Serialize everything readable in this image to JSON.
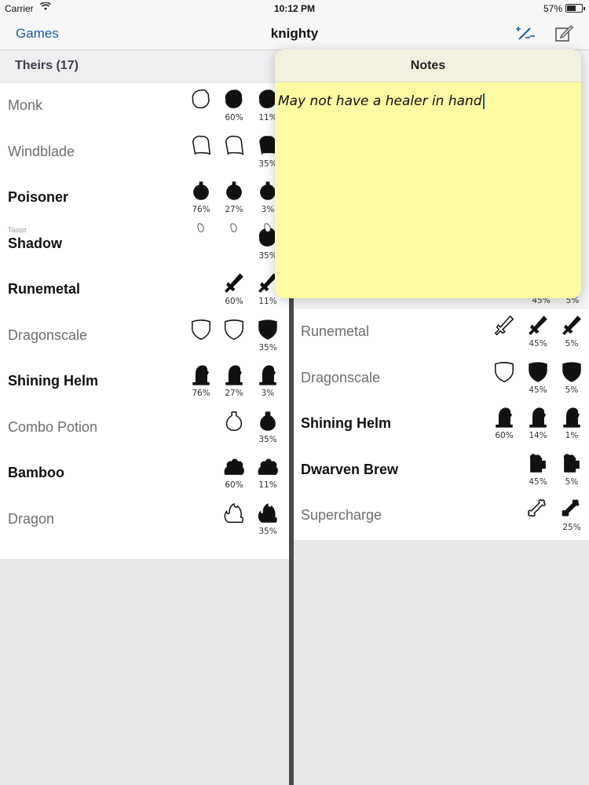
{
  "status_bar": {
    "carrier": "Carrier",
    "time": "10:12 PM",
    "battery": "57%"
  },
  "nav": {
    "back_label": "Games",
    "title": "knighty",
    "icons": [
      "wand-icon",
      "compose-icon"
    ]
  },
  "left_pane": {
    "section_title": "Theirs (17)",
    "rows": [
      {
        "name": "Monk",
        "active": false,
        "cells": [
          {
            "icon": "blob",
            "fill": "outline",
            "pct": ""
          },
          {
            "icon": "blob",
            "fill": "solid",
            "pct": "60%"
          },
          {
            "icon": "blob",
            "fill": "solid",
            "pct": "11%"
          }
        ]
      },
      {
        "name": "Windblade",
        "active": false,
        "cells": [
          {
            "icon": "cloak",
            "fill": "outline",
            "pct": ""
          },
          {
            "icon": "cloak",
            "fill": "outline",
            "pct": ""
          },
          {
            "icon": "cloak",
            "fill": "solid",
            "pct": "35%"
          }
        ]
      },
      {
        "name": "Poisoner",
        "active": true,
        "cells": [
          {
            "icon": "bomb",
            "fill": "solid",
            "pct": "76%"
          },
          {
            "icon": "bomb",
            "fill": "solid",
            "pct": "27%"
          },
          {
            "icon": "bomb",
            "fill": "solid",
            "pct": "3%"
          }
        ]
      },
      {
        "name": "Shadow",
        "active": true,
        "cells": [
          {
            "icon": "none",
            "fill": "",
            "pct": ""
          },
          {
            "icon": "none",
            "fill": "",
            "pct": ""
          },
          {
            "icon": "blob",
            "fill": "solid",
            "pct": "35%"
          }
        ]
      },
      {
        "name": "Runemetal",
        "active": true,
        "cells": [
          {
            "icon": "none",
            "fill": "",
            "pct": ""
          },
          {
            "icon": "sword",
            "fill": "solid",
            "pct": "60%"
          },
          {
            "icon": "sword",
            "fill": "solid",
            "pct": "11%"
          }
        ]
      },
      {
        "name": "Dragonscale",
        "active": false,
        "cells": [
          {
            "icon": "shield",
            "fill": "outline",
            "pct": ""
          },
          {
            "icon": "shield",
            "fill": "outline",
            "pct": ""
          },
          {
            "icon": "shield",
            "fill": "solid",
            "pct": "35%"
          }
        ]
      },
      {
        "name": "Shining Helm",
        "active": true,
        "cells": [
          {
            "icon": "helm",
            "fill": "solid",
            "pct": "76%"
          },
          {
            "icon": "helm",
            "fill": "solid",
            "pct": "27%"
          },
          {
            "icon": "helm",
            "fill": "solid",
            "pct": "3%"
          }
        ]
      },
      {
        "name": "Combo Potion",
        "active": false,
        "cells": [
          {
            "icon": "none",
            "fill": "",
            "pct": ""
          },
          {
            "icon": "potion",
            "fill": "outline",
            "pct": ""
          },
          {
            "icon": "potion",
            "fill": "solid",
            "pct": "35%"
          }
        ]
      },
      {
        "name": "Bamboo",
        "active": true,
        "cells": [
          {
            "icon": "none",
            "fill": "",
            "pct": ""
          },
          {
            "icon": "bush",
            "fill": "solid",
            "pct": "60%"
          },
          {
            "icon": "bush",
            "fill": "solid",
            "pct": "11%"
          }
        ]
      },
      {
        "name": "Dragon",
        "active": false,
        "cells": [
          {
            "icon": "none",
            "fill": "",
            "pct": ""
          },
          {
            "icon": "flame",
            "fill": "outline",
            "pct": ""
          },
          {
            "icon": "flame",
            "fill": "solid",
            "pct": "35%"
          }
        ]
      }
    ],
    "sublabel": "Taoist"
  },
  "right_pane": {
    "partial_pcts": [
      "45%",
      "5%"
    ],
    "rows": [
      {
        "name": "Runemetal",
        "active": false,
        "cells": [
          {
            "icon": "sword",
            "fill": "outline",
            "pct": ""
          },
          {
            "icon": "sword",
            "fill": "solid",
            "pct": "45%"
          },
          {
            "icon": "sword",
            "fill": "solid",
            "pct": "5%"
          }
        ]
      },
      {
        "name": "Dragonscale",
        "active": false,
        "cells": [
          {
            "icon": "shield",
            "fill": "outline",
            "pct": ""
          },
          {
            "icon": "shield",
            "fill": "solid",
            "pct": "45%"
          },
          {
            "icon": "shield",
            "fill": "solid",
            "pct": "5%"
          }
        ]
      },
      {
        "name": "Shining Helm",
        "active": true,
        "cells": [
          {
            "icon": "helm",
            "fill": "solid",
            "pct": "60%"
          },
          {
            "icon": "helm",
            "fill": "solid",
            "pct": "14%"
          },
          {
            "icon": "helm",
            "fill": "solid",
            "pct": "1%"
          }
        ]
      },
      {
        "name": "Dwarven Brew",
        "active": true,
        "cells": [
          {
            "icon": "none",
            "fill": "",
            "pct": ""
          },
          {
            "icon": "mug",
            "fill": "solid",
            "pct": "45%"
          },
          {
            "icon": "mug",
            "fill": "solid",
            "pct": "5%"
          }
        ]
      },
      {
        "name": "Supercharge",
        "active": false,
        "cells": [
          {
            "icon": "none",
            "fill": "",
            "pct": ""
          },
          {
            "icon": "bone",
            "fill": "outline",
            "pct": ""
          },
          {
            "icon": "bone",
            "fill": "solid",
            "pct": "25%"
          }
        ]
      }
    ]
  },
  "notes": {
    "title": "Notes",
    "text": "May not have a healer in hand"
  }
}
